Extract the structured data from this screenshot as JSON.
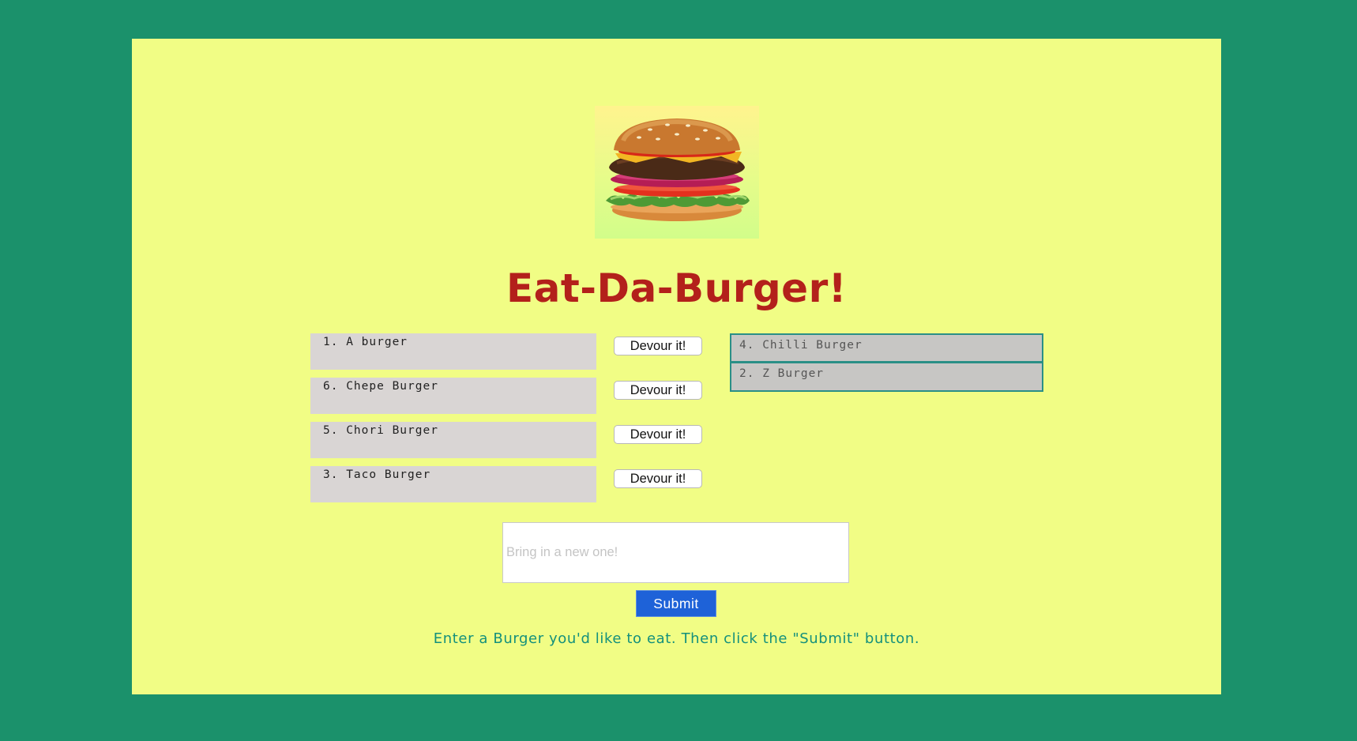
{
  "app": {
    "title": "Eat-Da-Burger!"
  },
  "logo": {
    "icon": "burger-image"
  },
  "burgers": [
    {
      "label": "1. A burger"
    },
    {
      "label": "6. Chepe Burger"
    },
    {
      "label": "5. Chori Burger"
    },
    {
      "label": "3. Taco Burger"
    }
  ],
  "devour_label": "Devour it!",
  "devoured": [
    {
      "label": "4. Chilli Burger"
    },
    {
      "label": "2. Z Burger"
    }
  ],
  "form": {
    "placeholder": "Bring in a new one!",
    "value": "",
    "submit_label": "Submit",
    "help": "Enter a Burger you'd like to eat. Then click the \"Submit\" button."
  },
  "colors": {
    "background": "#1b916b",
    "panel": "#f1fd85",
    "title": "#b3201b",
    "submit": "#1e62d8",
    "help_text": "#14907c"
  }
}
